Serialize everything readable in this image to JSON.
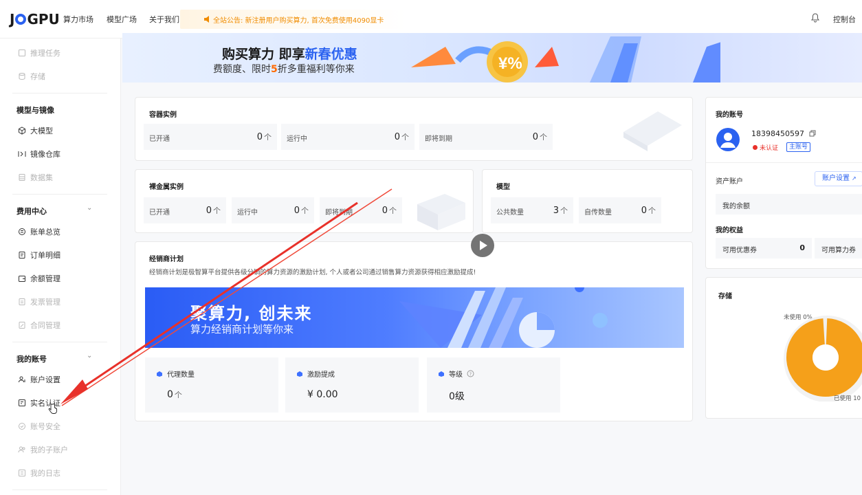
{
  "header": {
    "logo": "JOGPU",
    "nav": [
      "算力市场",
      "模型广场",
      "关于我们"
    ],
    "announcement": "全站公告: 新注册用户购买算力, 首次免费使用4090显卡",
    "console": "控制台"
  },
  "sidebar": {
    "top_items": [
      "推理任务",
      "存储"
    ],
    "group_model": "模型与镜像",
    "model_items": [
      "大模型",
      "镜像仓库",
      "数据集"
    ],
    "group_billing": "费用中心",
    "billing_items": [
      "账单总览",
      "订单明细",
      "余额管理",
      "发票管理",
      "合同管理"
    ],
    "group_account": "我的账号",
    "account_items": [
      "账户设置",
      "实名认证",
      "账号安全",
      "我的子账户",
      "我的日志"
    ]
  },
  "banner": {
    "title_a": "购买算力 即享",
    "title_b": "新春优惠",
    "sub_a": "费额度、限时",
    "sub_num": "5",
    "sub_b": "折多重福利等你来",
    "coin": "¥%"
  },
  "container": {
    "title": "容器实例",
    "cells": [
      {
        "label": "已开通",
        "value": "0",
        "unit": "个"
      },
      {
        "label": "运行中",
        "value": "0",
        "unit": "个"
      },
      {
        "label": "即将到期",
        "value": "0",
        "unit": "个"
      }
    ]
  },
  "bare_metal": {
    "title": "裸金属实例",
    "cells": [
      {
        "label": "已开通",
        "value": "0",
        "unit": "个"
      },
      {
        "label": "运行中",
        "value": "0",
        "unit": "个"
      },
      {
        "label": "即将到期",
        "value": "0",
        "unit": "个"
      }
    ]
  },
  "model": {
    "title": "模型",
    "cells": [
      {
        "label": "公共数量",
        "value": "3",
        "unit": "个"
      },
      {
        "label": "自传数量",
        "value": "0",
        "unit": "个"
      }
    ]
  },
  "reseller": {
    "title": "经销商计划",
    "desc": "经销商计划是极智算平台提供各级分销的算力资源的激励计划, 个人或者公司通过销售算力资源获得相应激励提成!",
    "promo_title": "聚算力, 创未来",
    "promo_sub": "算力经销商计划等你来",
    "stats": [
      {
        "label": "代理数量",
        "value": "0",
        "unit": "个"
      },
      {
        "label": "激励提成",
        "value": "¥ 0.00",
        "unit": ""
      },
      {
        "label": "等级",
        "value": "0级",
        "unit": ""
      }
    ]
  },
  "account": {
    "title": "我的账号",
    "phone": "18398450597",
    "verify_status": "未认证",
    "main_tag": "主账号",
    "asset_title": "资产账户",
    "settings_btn": "账户设置",
    "balance_label": "我的余额",
    "rights_title": "我的权益",
    "coupon_label": "可用优惠券",
    "coupon_value": "0",
    "voucher_label": "可用算力券"
  },
  "storage": {
    "title": "存储",
    "unused_label": "未使用 0%",
    "used_label": "已使用 10",
    "used_fraction": 0.99,
    "used_color": "#f5a01a",
    "unused_color": "#f0f0f0"
  },
  "colors": {
    "accent": "#2b62f0",
    "warning": "#f08c00",
    "arrow": "#e8312a"
  }
}
